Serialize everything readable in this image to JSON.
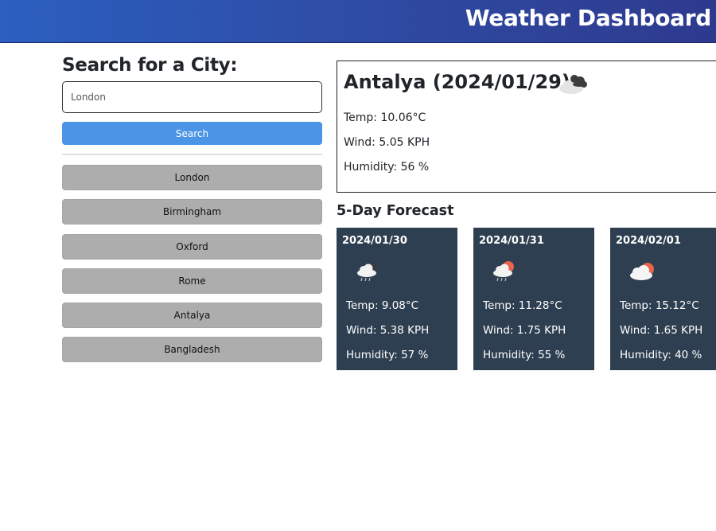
{
  "header": {
    "title": "Weather Dashboard"
  },
  "search": {
    "heading": "Search for a City:",
    "input_value": "London",
    "button_label": "Search"
  },
  "history": [
    "London",
    "Birmingham",
    "Oxford",
    "Rome",
    "Antalya",
    "Bangladesh"
  ],
  "current": {
    "title": "Antalya (2024/01/29)",
    "icon": "dark-cloud-icon",
    "temp": "Temp: 10.06°C",
    "wind": "Wind: 5.05 KPH",
    "humidity": "Humidity: 56 %"
  },
  "forecast": {
    "heading": "5-Day Forecast",
    "days": [
      {
        "date": "2024/01/30",
        "icon": "rain-cloud-icon",
        "temp": "Temp: 9.08°C",
        "wind": "Wind: 5.38 KPH",
        "humidity": "Humidity: 57 %"
      },
      {
        "date": "2024/01/31",
        "icon": "sun-rain-cloud-icon",
        "temp": "Temp: 11.28°C",
        "wind": "Wind: 1.75 KPH",
        "humidity": "Humidity: 55 %"
      },
      {
        "date": "2024/02/01",
        "icon": "sun-cloud-icon",
        "temp": "Temp: 15.12°C",
        "wind": "Wind: 1.65 KPH",
        "humidity": "Humidity: 40 %"
      }
    ]
  },
  "colors": {
    "header_gradient_start": "#2b5fc0",
    "header_gradient_end": "#2d3a8e",
    "search_button": "#4b95e6",
    "history_button": "#adadad",
    "forecast_card": "#2e3f51",
    "sun": "#e8644a"
  }
}
